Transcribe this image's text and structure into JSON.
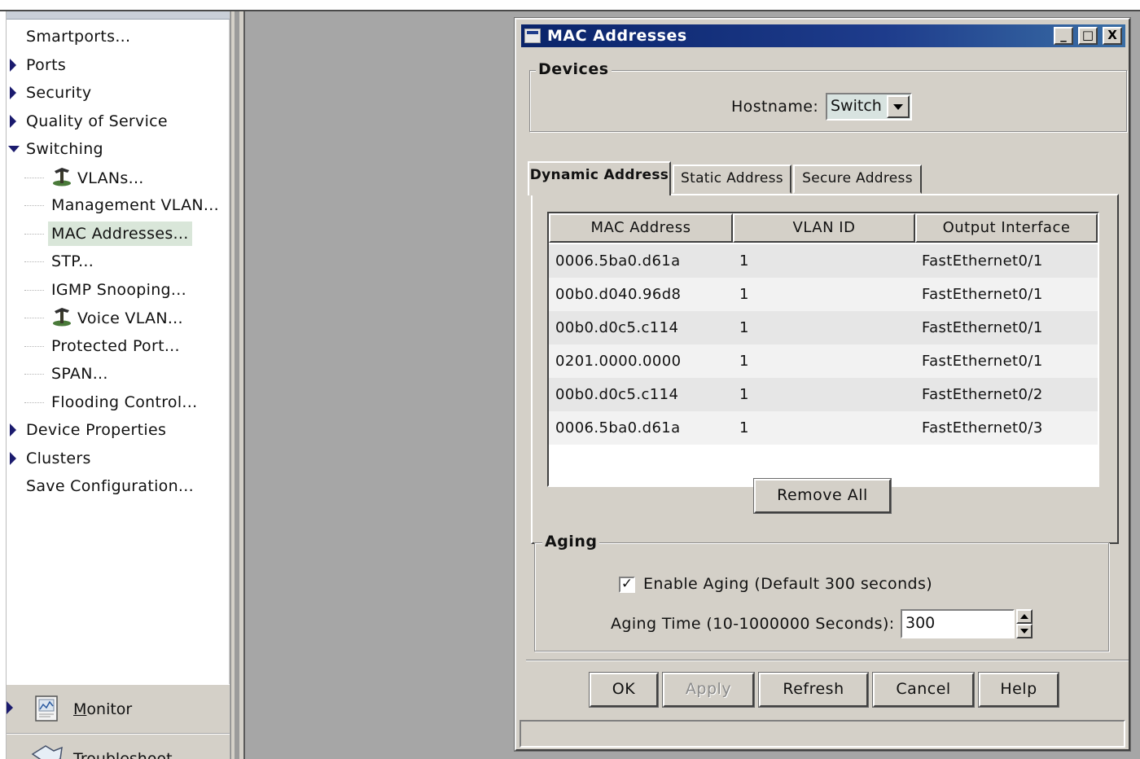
{
  "nav": {
    "items": [
      {
        "label": "Smartports...",
        "type": "leaf-top"
      },
      {
        "label": "Ports",
        "type": "collapsed"
      },
      {
        "label": "Security",
        "type": "collapsed"
      },
      {
        "label": "Quality of Service",
        "type": "collapsed"
      },
      {
        "label": "Switching",
        "type": "expanded"
      },
      {
        "label": "VLANs...",
        "type": "child-icon"
      },
      {
        "label": "Management VLAN...",
        "type": "child"
      },
      {
        "label": "MAC Addresses...",
        "type": "child-selected"
      },
      {
        "label": "STP...",
        "type": "child"
      },
      {
        "label": "IGMP Snooping...",
        "type": "child"
      },
      {
        "label": "Voice VLAN...",
        "type": "child-icon"
      },
      {
        "label": "Protected Port...",
        "type": "child"
      },
      {
        "label": "SPAN...",
        "type": "child"
      },
      {
        "label": "Flooding Control...",
        "type": "child"
      },
      {
        "label": "Device Properties",
        "type": "collapsed"
      },
      {
        "label": "Clusters",
        "type": "collapsed"
      },
      {
        "label": "Save Configuration...",
        "type": "leaf-top"
      }
    ],
    "monitor_label": "Monitor",
    "monitor_underline": "M",
    "monitor_rest": "onitor",
    "troubleshoot_partial": "Troubleshoot"
  },
  "dialog": {
    "title": "MAC Addresses",
    "window_buttons": {
      "minimize": "_",
      "maximize": "□",
      "close": "X"
    },
    "devices": {
      "legend": "Devices",
      "hostname_label": "Hostname:",
      "hostname_value": "Switch"
    },
    "tabs": [
      "Dynamic Address",
      "Static Address",
      "Secure Address"
    ],
    "active_tab": 0,
    "table": {
      "columns": [
        "MAC Address",
        "VLAN ID",
        "Output Interface"
      ],
      "rows": [
        [
          "0006.5ba0.d61a",
          "1",
          "FastEthernet0/1"
        ],
        [
          "00b0.d040.96d8",
          "1",
          "FastEthernet0/1"
        ],
        [
          "00b0.d0c5.c114",
          "1",
          "FastEthernet0/1"
        ],
        [
          "0201.0000.0000",
          "1",
          "FastEthernet0/1"
        ],
        [
          "00b0.d0c5.c114",
          "1",
          "FastEthernet0/2"
        ],
        [
          "0006.5ba0.d61a",
          "1",
          "FastEthernet0/3"
        ]
      ]
    },
    "remove_all_label": "Remove All",
    "aging": {
      "legend": "Aging",
      "enable_label": "Enable Aging (Default 300 seconds)",
      "enable_checked": true,
      "check_glyph": "✓",
      "time_label": "Aging Time (10-1000000 Seconds):",
      "time_value": "300"
    },
    "buttons": {
      "ok": "OK",
      "apply": "Apply",
      "refresh": "Refresh",
      "cancel": "Cancel",
      "help": "Help"
    }
  },
  "colors": {
    "titlebar": "#0a246a",
    "selection": "#d9e6d9",
    "tree_arrow": "#1b1b6e",
    "window_bg": "#d4d0c8"
  }
}
